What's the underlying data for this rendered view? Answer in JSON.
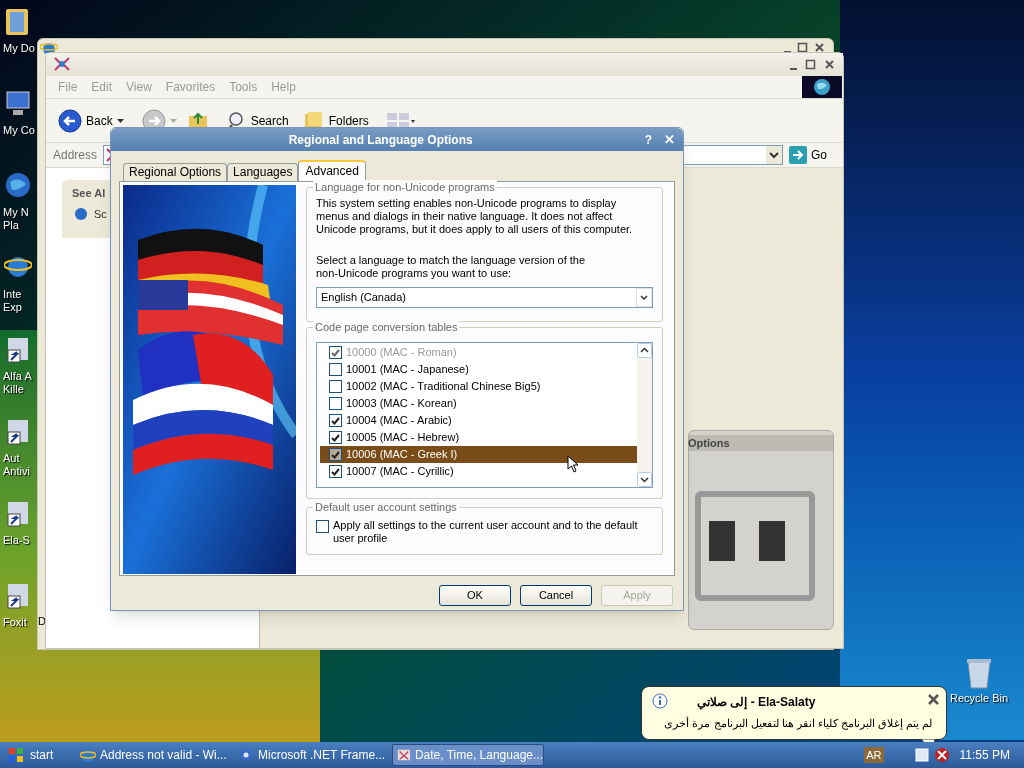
{
  "desktop_icons": [
    {
      "kind": "folder",
      "lines": [
        "My Do"
      ]
    },
    {
      "kind": "computer",
      "lines": [
        "My Co"
      ]
    },
    {
      "kind": "globe",
      "lines": [
        "My N",
        "Pla"
      ]
    },
    {
      "kind": "browser",
      "lines": [
        "Inte",
        "Exp"
      ]
    },
    {
      "kind": "shortcut",
      "lines": [
        "Alfa A",
        "Kille"
      ]
    },
    {
      "kind": "shortcut",
      "lines": [
        "Aut",
        "Antivi"
      ]
    },
    {
      "kind": "shortcut",
      "lines": [
        "Ela-S"
      ]
    },
    {
      "kind": "shortcut",
      "lines": [
        "Foxit"
      ]
    }
  ],
  "back_window": {
    "fragment": "D"
  },
  "explorer": {
    "menu": [
      "File",
      "Edit",
      "View",
      "Favorites",
      "Tools",
      "Help"
    ],
    "toolbar": {
      "back": "Back",
      "search": "Search",
      "folders": "Folders"
    },
    "address": {
      "label": "Address",
      "go": "Go"
    },
    "see_also": {
      "title": "See Al",
      "items": [
        "Sc"
      ]
    },
    "content_item": "Options"
  },
  "dialog": {
    "title": "Regional and Language Options",
    "help": "?",
    "close": "✕",
    "tabs": [
      {
        "label": "Regional Options",
        "selected": false
      },
      {
        "label": "Languages",
        "selected": false
      },
      {
        "label": "Advanced",
        "selected": true
      }
    ],
    "language_group": {
      "legend": "Language for non-Unicode programs",
      "description": "This system setting enables non-Unicode programs to display menus and dialogs in their native language. It does not affect Unicode programs, but it does apply to all users of this computer.",
      "prompt": "Select a language to match the language version of the non-Unicode programs you want to use:",
      "value": "English (Canada)"
    },
    "code_pages": {
      "legend": "Code page conversion tables",
      "items": [
        {
          "label": "10000 (MAC - Roman)",
          "checked": true,
          "disabled": true,
          "selected": false
        },
        {
          "label": "10001 (MAC - Japanese)",
          "checked": false,
          "disabled": false,
          "selected": false
        },
        {
          "label": "10002 (MAC - Traditional Chinese Big5)",
          "checked": false,
          "disabled": false,
          "selected": false
        },
        {
          "label": "10003 (MAC - Korean)",
          "checked": false,
          "disabled": false,
          "selected": false
        },
        {
          "label": "10004 (MAC - Arabic)",
          "checked": true,
          "disabled": false,
          "selected": false
        },
        {
          "label": "10005 (MAC - Hebrew)",
          "checked": true,
          "disabled": false,
          "selected": false
        },
        {
          "label": "10006 (MAC - Greek I)",
          "checked": true,
          "disabled": false,
          "selected": true
        },
        {
          "label": "10007 (MAC - Cyrillic)",
          "checked": true,
          "disabled": false,
          "selected": false
        }
      ]
    },
    "default_user": {
      "legend": "Default user account settings",
      "label": "Apply all settings to the current user account and to the default user profile",
      "checked": false
    },
    "buttons": [
      {
        "label": "OK",
        "disabled": false
      },
      {
        "label": "Cancel",
        "disabled": false
      },
      {
        "label": "Apply",
        "disabled": true
      }
    ]
  },
  "recycle_bin": "Recycle Bin",
  "balloon": {
    "title": "Ela-Salaty - إلى صلاتي",
    "text": "لم يتم إغلاق البرنامج كلياء انقر هنا  لتفعيل البرنامج مرة أخرى"
  },
  "taskbar": {
    "start": "start",
    "tasks": [
      {
        "kind": "browser",
        "label": "Address not valid - Wi...",
        "selected": false
      },
      {
        "kind": "gear",
        "label": "Microsoft .NET Frame...",
        "selected": false
      },
      {
        "kind": "panel",
        "label": "Date, Time, Language...",
        "selected": true
      }
    ],
    "language": "AR",
    "clock": "11:55 PM"
  }
}
